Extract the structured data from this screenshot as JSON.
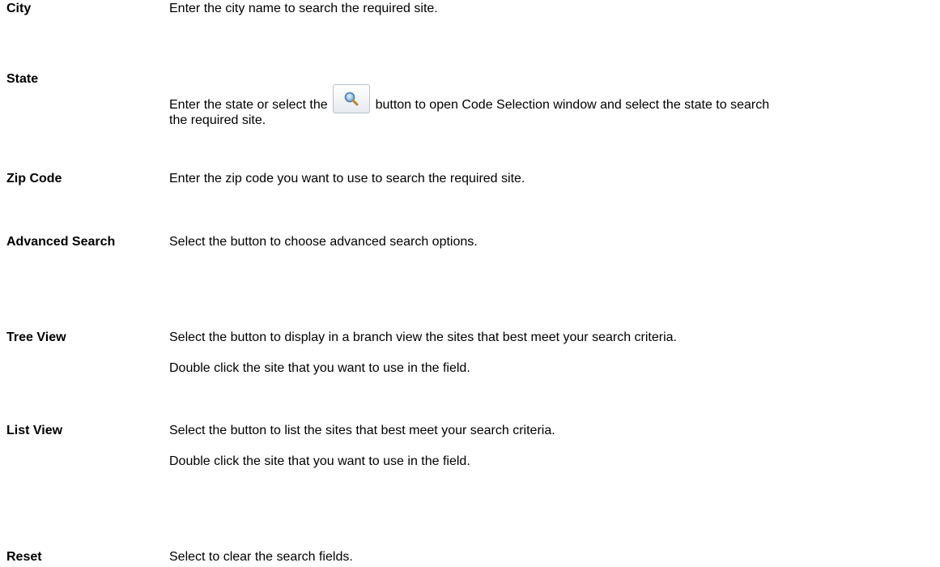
{
  "fields": [
    {
      "id": "city",
      "term": "City",
      "desc": "Enter the city name to search the required site."
    },
    {
      "id": "state",
      "term": "State",
      "desc_before": "Enter the state or select the",
      "desc_after": "button  to open Code Selection window and select the state to search the required site.",
      "button_icon": "magnifier-icon"
    },
    {
      "id": "zip",
      "term": "Zip Code",
      "desc": "Enter the zip code you want to use to search the required site."
    },
    {
      "id": "advanced",
      "term": "Advanced Search",
      "desc": "Select the button to choose advanced search options."
    },
    {
      "id": "tree",
      "term": "Tree View",
      "desc": "Select the button to display in a branch view the sites that best meet your search criteria.",
      "desc2": "Double click the site that you want to use in the field."
    },
    {
      "id": "list",
      "term": "List View",
      "desc": "Select the button to list the sites that best meet your search criteria.",
      "desc2": "Double click the site that you want to use in the field."
    },
    {
      "id": "reset",
      "term": "Reset",
      "desc": "Select to clear the search fields."
    }
  ]
}
